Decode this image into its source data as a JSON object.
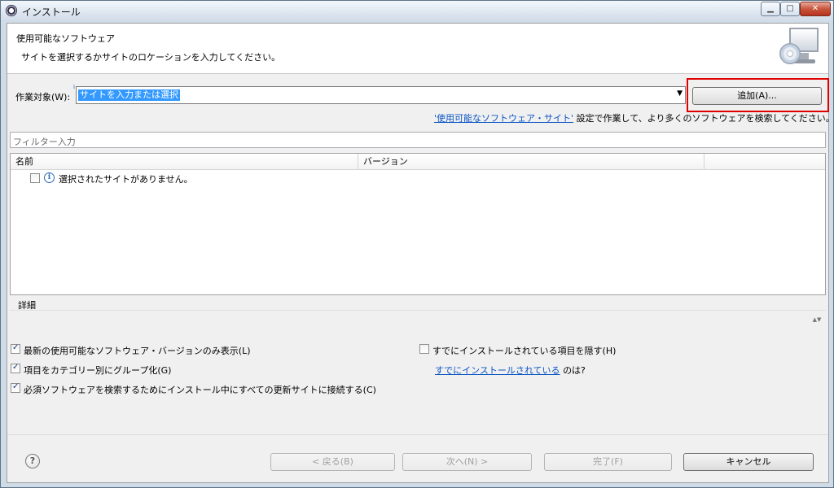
{
  "window": {
    "title": "インストール",
    "min_glyph": "▁",
    "max_glyph": "□",
    "close_glyph": "✕"
  },
  "header": {
    "title": "使用可能なソフトウェア",
    "description": "サイトを選択するかサイトのロケーションを入力してください。",
    "icon": "monitor-cd-icon"
  },
  "work_with": {
    "label": "作業対象(W):",
    "info_glyph": "i",
    "value": "サイトを入力または選択",
    "arrow": "▼",
    "add_button": "追加(A)..."
  },
  "sites_hint": {
    "link": "'使用可能なソフトウェア・サイト'",
    "suffix": "設定で作業して、より多くのソフトウェアを検索してください。"
  },
  "filter": {
    "placeholder": "フィルター入力"
  },
  "table": {
    "columns": [
      "名前",
      "バージョン",
      ""
    ],
    "rows": [
      {
        "text": "選択されたサイトがありません。",
        "checked": false,
        "icon": "info-icon"
      }
    ]
  },
  "details": {
    "label": "詳細",
    "spinner": "▲▼"
  },
  "options": {
    "latest_only": {
      "label": "最新の使用可能なソフトウェア・バージョンのみ表示(L)",
      "checked": true
    },
    "group_by_category": {
      "label": "項目をカテゴリー別にグループ化(G)",
      "checked": true
    },
    "contact_all_sites": {
      "label": "必須ソフトウェアを検索するためにインストール中にすべての更新サイトに接続する(C)",
      "checked": true
    },
    "hide_installed": {
      "label": "すでにインストールされている項目を隠す(H)",
      "checked": false
    }
  },
  "installed_hint": {
    "link": "すでにインストールされている",
    "suffix": "のは?"
  },
  "footer": {
    "help_glyph": "?",
    "back": "< 戻る(B)",
    "next": "次へ(N) >",
    "finish": "完了(F)",
    "cancel": "キャンセル"
  }
}
